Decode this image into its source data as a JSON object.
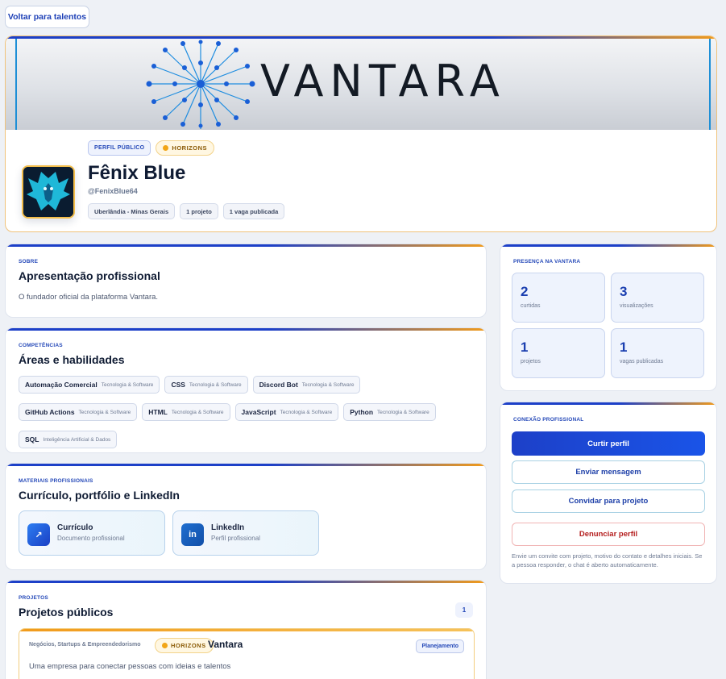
{
  "nav": {
    "back_label": "Voltar para talentos"
  },
  "banner": {
    "wordmark": "VANTARA"
  },
  "profile": {
    "public_label": "PERFIL PÚBLICO",
    "horizons_label": "HORIZONS",
    "name": "Fênix Blue",
    "handle": "@FenixBlue64",
    "meta": [
      "Uberlândia - Minas Gerais",
      "1 projeto",
      "1 vaga publicada"
    ]
  },
  "about": {
    "eyebrow": "SOBRE",
    "title": "Apresentação profissional",
    "text": "O fundador oficial da plataforma Vantara."
  },
  "skills": {
    "eyebrow": "COMPETÊNCIAS",
    "title": "Áreas e habilidades",
    "items": [
      {
        "name": "Automação Comercial",
        "category": "Tecnologia & Software"
      },
      {
        "name": "CSS",
        "category": "Tecnologia & Software"
      },
      {
        "name": "Discord Bot",
        "category": "Tecnologia & Software"
      },
      {
        "name": "GitHub Actions",
        "category": "Tecnologia & Software"
      },
      {
        "name": "HTML",
        "category": "Tecnologia & Software"
      },
      {
        "name": "JavaScript",
        "category": "Tecnologia & Software"
      },
      {
        "name": "Python",
        "category": "Tecnologia & Software"
      },
      {
        "name": "SQL",
        "category": "Inteligência Artificial & Dados"
      }
    ]
  },
  "materials": {
    "eyebrow": "MATERIAIS PROFISSIONAIS",
    "title": "Currículo, portfólio e LinkedIn",
    "items": [
      {
        "icon": "↗",
        "title": "Currículo",
        "subtitle": "Documento profissional"
      },
      {
        "icon": "in",
        "title": "LinkedIn",
        "subtitle": "Perfil profissional"
      }
    ]
  },
  "projects": {
    "eyebrow": "PROJETOS",
    "title": "Projetos públicos",
    "count": "1",
    "items": [
      {
        "category": "Negócios, Startups & Empreendedorismo",
        "badge": "HORIZONS",
        "name": "Vantara",
        "status": "Planejamento",
        "description": "Uma empresa para conectar pessoas com ideias e talentos"
      }
    ]
  },
  "presence": {
    "eyebrow": "PRESENÇA NA VANTARA",
    "stats": [
      {
        "value": "2",
        "label": "curtidas"
      },
      {
        "value": "3",
        "label": "visualizações"
      },
      {
        "value": "1",
        "label": "projetos"
      },
      {
        "value": "1",
        "label": "vagas publicadas"
      }
    ]
  },
  "connection": {
    "eyebrow": "CONEXÃO PROFISSIONAL",
    "like_label": "Curtir perfil",
    "message_label": "Enviar mensagem",
    "invite_label": "Convidar para projeto",
    "report_label": "Denunciar perfil",
    "note": "Envie um convite com projeto, motivo do contato e detalhes iniciais. Se a pessoa responder, o chat é aberto automaticamente."
  },
  "colors": {
    "primary": "#1d40c8",
    "accent": "#f19b1c",
    "danger": "#b41d1d",
    "background": "#eef1f6"
  }
}
